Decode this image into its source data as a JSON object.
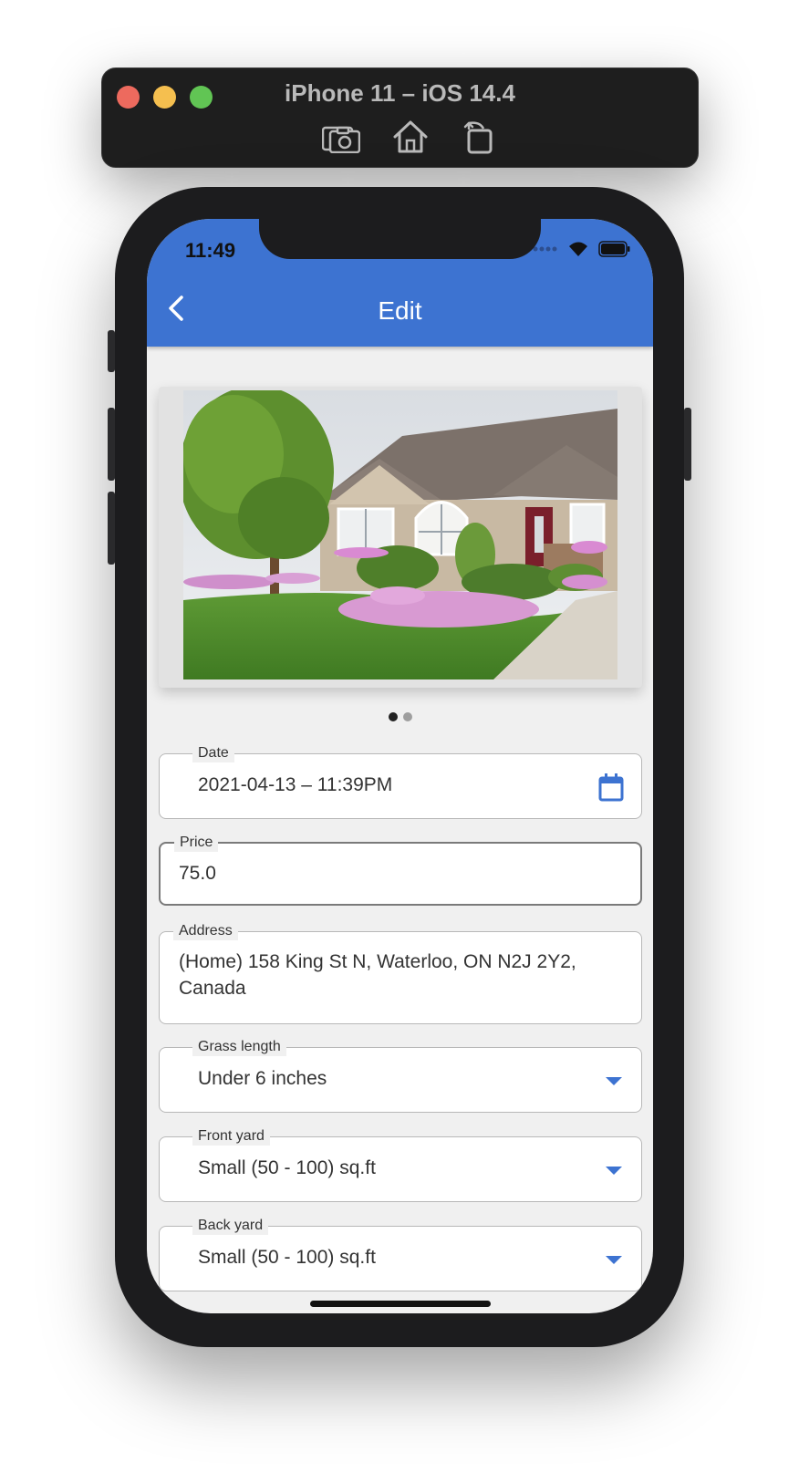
{
  "simulator": {
    "title": "iPhone 11 – iOS 14.4",
    "tools": [
      "screenshot-icon",
      "home-icon",
      "rotate-icon"
    ]
  },
  "status_bar": {
    "time": "11:49"
  },
  "app_bar": {
    "title": "Edit",
    "back_icon": "chevron-left-icon",
    "color": "#3d73d1"
  },
  "carousel": {
    "image": "house-front-yard-photo",
    "page_count": 2,
    "active_page": 1
  },
  "form": {
    "date": {
      "label": "Date",
      "value": "2021-04-13 – 11:39PM",
      "icon": "calendar-icon"
    },
    "price": {
      "label": "Price",
      "value": "75.0"
    },
    "address": {
      "label": "Address",
      "value_line1": "(Home) 158 King St N, Waterloo, ON N2J 2Y2,",
      "value_line2": "Canada"
    },
    "grass_length": {
      "label": "Grass length",
      "value": "Under 6 inches",
      "icon": "dropdown-arrow-icon"
    },
    "front_yard": {
      "label": "Front yard",
      "value": "Small (50 - 100) sq.ft",
      "icon": "dropdown-arrow-icon"
    },
    "back_yard": {
      "label": "Back yard",
      "value": "Small (50 - 100) sq.ft",
      "icon": "dropdown-arrow-icon"
    }
  }
}
